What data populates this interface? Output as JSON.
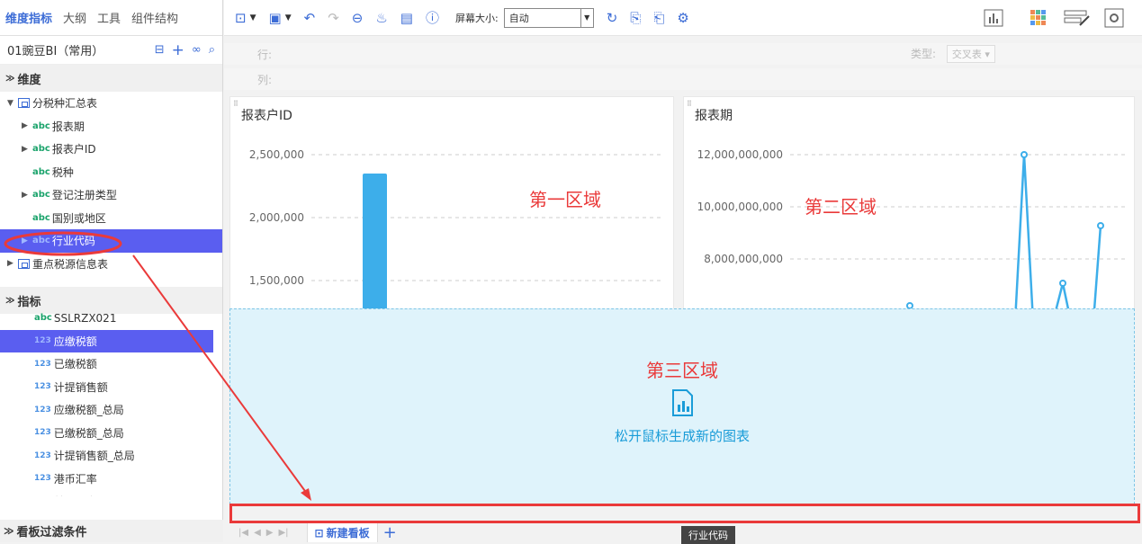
{
  "left_tabs": [
    "维度指标",
    "大纲",
    "工具",
    "组件结构"
  ],
  "datasource": {
    "title": "01豌豆BI（常用）"
  },
  "dimension_section": "维度",
  "dimension_tree": [
    {
      "label": "分税种汇总表",
      "type": "table",
      "expand": "▼",
      "level": 0
    },
    {
      "label": "报表期",
      "type": "abc",
      "expand": "▶",
      "level": 1
    },
    {
      "label": "报表户ID",
      "type": "abc",
      "expand": "▶",
      "level": 1
    },
    {
      "label": "税种",
      "type": "abc",
      "expand": "",
      "level": 1
    },
    {
      "label": "登记注册类型",
      "type": "abc",
      "expand": "▶",
      "level": 1
    },
    {
      "label": "国别或地区",
      "type": "abc",
      "expand": "",
      "level": 1
    },
    {
      "label": "行业代码",
      "type": "abc",
      "expand": "▶",
      "level": 1,
      "selected": true
    },
    {
      "label": "重点税源信息表",
      "type": "table",
      "expand": "▶",
      "level": 0
    }
  ],
  "metric_section": "指标",
  "metric_tree": [
    {
      "label": "SSLRZX021",
      "type": "abc"
    },
    {
      "label": "应缴税额",
      "type": "123",
      "selected": true
    },
    {
      "label": "已缴税额",
      "type": "123"
    },
    {
      "label": "计提销售额",
      "type": "123"
    },
    {
      "label": "应缴税额_总局",
      "type": "123"
    },
    {
      "label": "已缴税额_总局",
      "type": "123"
    },
    {
      "label": "计提销售额_总局",
      "type": "123"
    },
    {
      "label": "港币汇率",
      "type": "123"
    },
    {
      "label": "美元汇率",
      "type": "123"
    }
  ],
  "filter_section": "看板过滤条件",
  "toolbar": {
    "screen_label": "屏幕大小:",
    "screen_value": "自动"
  },
  "shelf": {
    "row_label": "行:",
    "col_label": "列:",
    "type_label": "类型:",
    "type_value": "交叉表 ▾"
  },
  "chart1": {
    "title": "报表户ID",
    "annotation": "第一区域"
  },
  "chart2": {
    "title": "报表期",
    "annotation": "第二区域"
  },
  "drop_zone": {
    "annotation": "第三区域",
    "message": "松开鼠标生成新的图表"
  },
  "board_tab": "新建看板",
  "drag_tooltip": "行业代码",
  "colors": {
    "accent": "#3c6cd6",
    "selected": "#5a5ef0",
    "chart_blue": "#3daeea",
    "annotation_red": "#ea3a3a"
  },
  "chart_data": [
    {
      "type": "bar",
      "title": "报表户ID",
      "y_ticks": [
        "2,500,000",
        "2,000,000",
        "1,500,000"
      ],
      "ylim": [
        1300000,
        2600000
      ],
      "values": [
        2350000
      ],
      "grid": true
    },
    {
      "type": "line",
      "title": "报表期",
      "y_ticks": [
        "12,000,000,000",
        "10,000,000,000",
        "8,000,000,000"
      ],
      "ylim": [
        7000000000,
        12500000000
      ],
      "grid": true
    }
  ]
}
